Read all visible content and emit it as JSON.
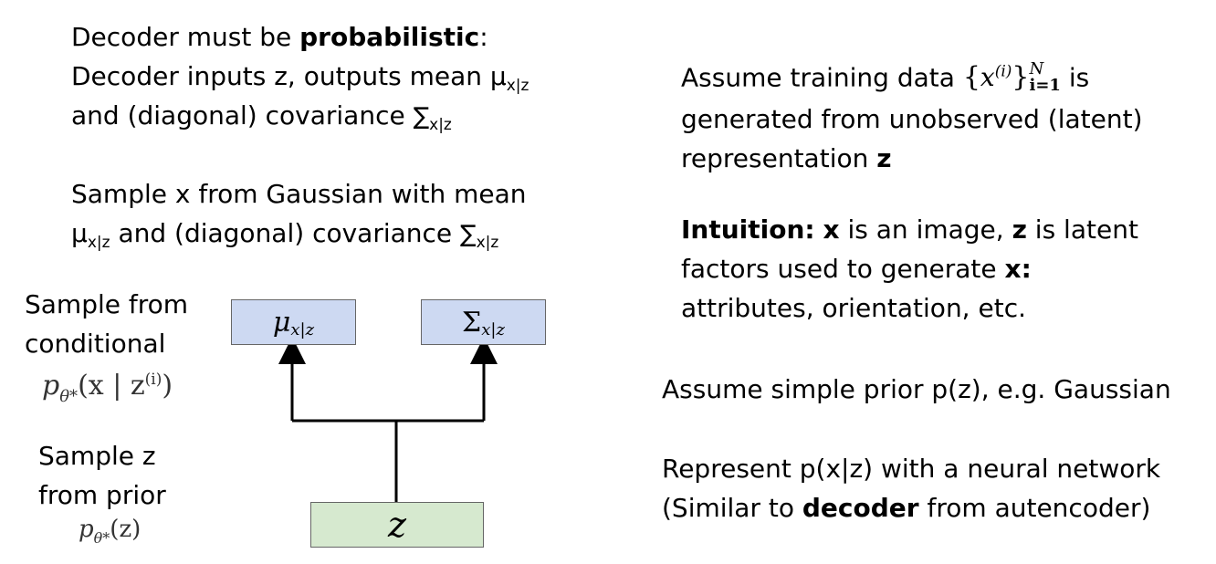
{
  "left": {
    "line1_pre": "Decoder must be ",
    "line1_bold": "probabilistic",
    "line1_post": ":",
    "line2_pre": "Decoder inputs z, outputs mean μ",
    "line2_sub": "x|z",
    "line3_pre": "and (diagonal) covariance ",
    "line3_sigma": "∑",
    "line3_sub": "x|z",
    "line4": "Sample x from Gaussian with mean",
    "line5_mu": "μ",
    "line5_sub": "x|z",
    "line5_mid": " and (diagonal) covariance ",
    "line5_sigma": "∑",
    "line5_sub2": "x|z"
  },
  "diagram": {
    "cond_label_1": "Sample from",
    "cond_label_2": "conditional",
    "cond_formula": "pθ* (x | z(i))",
    "cond_formula_parts": {
      "p": "p",
      "theta": "θ*",
      "args": "(x | z",
      "sup": "(i)",
      "close": ")"
    },
    "prior_label_1": "Sample z",
    "prior_label_2": "from prior",
    "prior_formula_parts": {
      "p": "p",
      "theta": "θ*",
      "args": "(z)"
    },
    "mu_box": {
      "symbol": "μ",
      "sub": "x|z"
    },
    "sigma_box": {
      "symbol": "Σ",
      "sub": "x|z"
    },
    "z_box": {
      "symbol": "z"
    },
    "colors": {
      "blue_box": "#cdd9f2",
      "green_box": "#d6e9cf",
      "wire": "#000000"
    }
  },
  "right": {
    "p1_pre": "Assume training data ",
    "p1_math": {
      "open": "{",
      "x": "x",
      "sup": "(i)",
      "close": "}",
      "upper": "N",
      "lower": "i=1"
    },
    "p1_post": " is",
    "p1_line2": "generated from unobserved (latent)",
    "p1_line3_pre": "representation ",
    "p1_line3_bold": "z",
    "p2_bold": "Intuition:",
    "p2_x": "x",
    "p2_mid": " is an image, ",
    "p2_z": "z",
    "p2_post": " is latent",
    "p2_line2_pre": "factors used to generate ",
    "p2_line2_bold": "x:",
    "p2_line3": "attributes, orientation, etc.",
    "p3": "Assume simple prior p(z), e.g. Gaussian",
    "p4_line1": "Represent p(x|z) with a neural network",
    "p4_line2_pre": "(Similar to ",
    "p4_line2_bold": "decoder",
    "p4_line2_post": " from autencoder)"
  }
}
